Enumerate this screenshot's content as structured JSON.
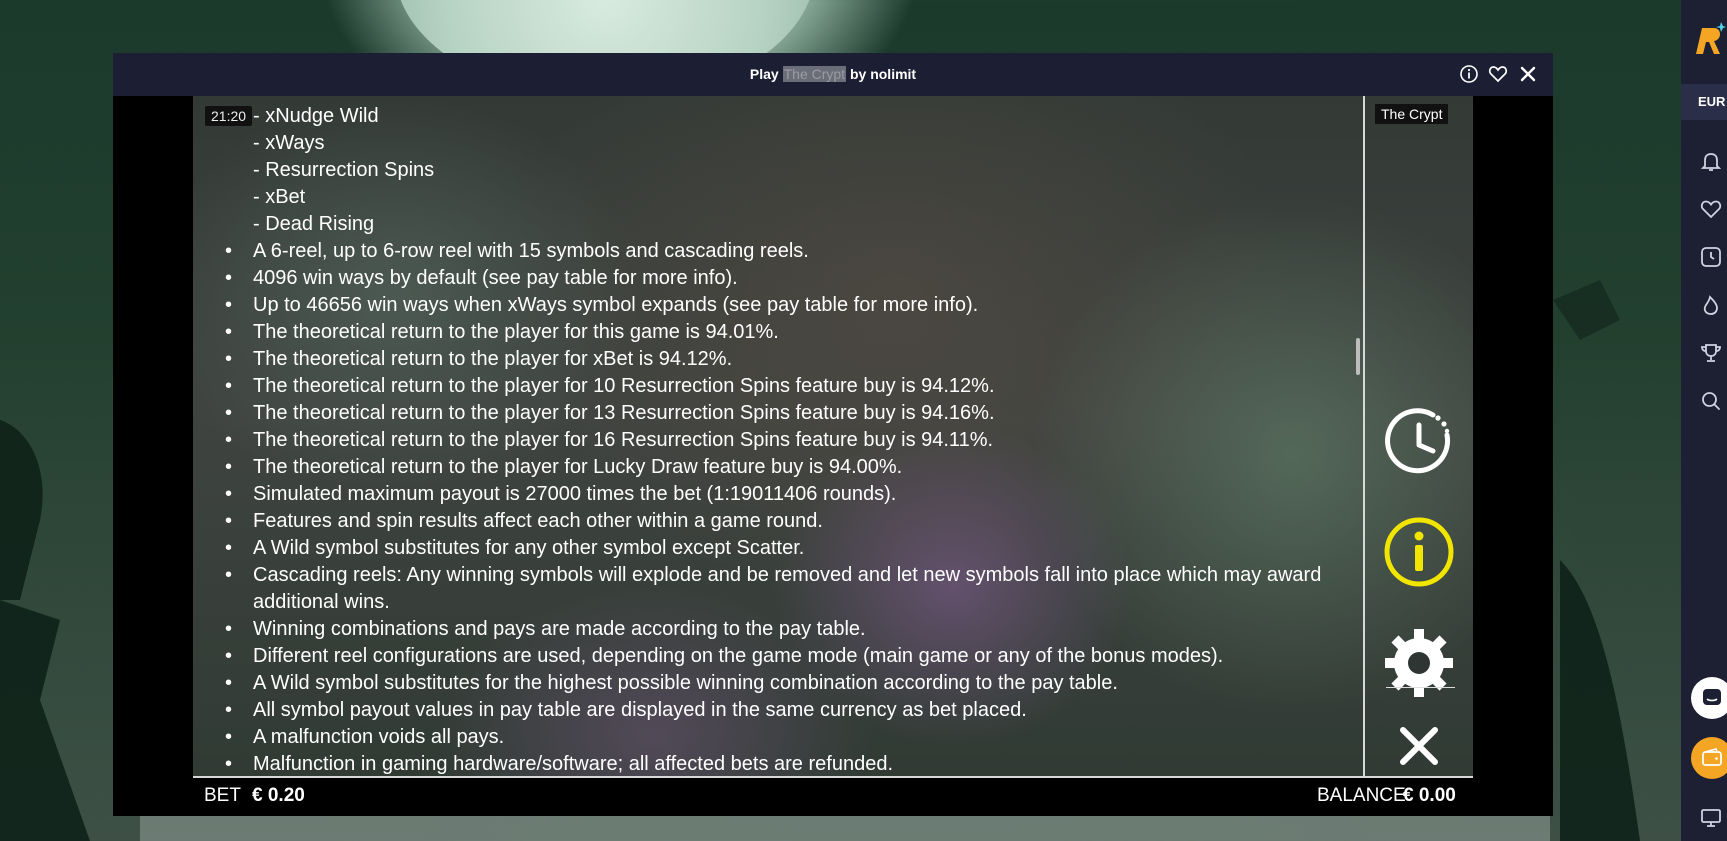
{
  "window": {
    "title_prefix": "Play ",
    "title_game": "The Crypt",
    "title_suffix": " by nolimit"
  },
  "game": {
    "clock": "21:20",
    "name_badge": "The Crypt",
    "rules_lines": [
      {
        "kind": "sub",
        "text": "- xNudge Wild"
      },
      {
        "kind": "sub",
        "text": "- xWays"
      },
      {
        "kind": "sub",
        "text": "- Resurrection Spins"
      },
      {
        "kind": "sub",
        "text": "- xBet"
      },
      {
        "kind": "sub",
        "text": "- Dead Rising"
      },
      {
        "kind": "bullet",
        "text": "A 6-reel, up to 6-row reel with 15 symbols and cascading reels."
      },
      {
        "kind": "bullet",
        "text": "4096 win ways by default (see pay table for more info)."
      },
      {
        "kind": "bullet",
        "text": "Up to 46656 win ways when xWays symbol expands (see pay table for more info)."
      },
      {
        "kind": "bullet",
        "text": "The theoretical return to the player for this game is 94.01%."
      },
      {
        "kind": "bullet",
        "text": "The theoretical return to the player for xBet is 94.12%."
      },
      {
        "kind": "bullet",
        "text": "The theoretical return to the player for 10 Resurrection Spins feature buy is 94.12%."
      },
      {
        "kind": "bullet",
        "text": "The theoretical return to the player for 13 Resurrection Spins feature buy is 94.16%."
      },
      {
        "kind": "bullet",
        "text": "The theoretical return to the player for 16 Resurrection Spins feature buy is 94.11%."
      },
      {
        "kind": "bullet",
        "text": "The theoretical return to the player for Lucky Draw feature buy is 94.00%."
      },
      {
        "kind": "bullet",
        "text": "Simulated maximum payout is 27000 times the bet (1:19011406 rounds)."
      },
      {
        "kind": "bullet",
        "text": "Features and spin results affect each other within a game round."
      },
      {
        "kind": "bullet",
        "text": "A Wild symbol substitutes for any other symbol except Scatter."
      },
      {
        "kind": "bullet",
        "text": "Cascading reels: Any winning symbols will explode and be removed and let new symbols fall into place which may award"
      },
      {
        "kind": "cont",
        "text": "additional wins."
      },
      {
        "kind": "bullet",
        "text": "Winning combinations and pays are made according to the pay table."
      },
      {
        "kind": "bullet",
        "text": "Different reel configurations are used, depending on the game mode (main game or any of the bonus modes)."
      },
      {
        "kind": "bullet",
        "text": "A Wild symbol substitutes for the highest possible winning combination according to the pay table."
      },
      {
        "kind": "bullet",
        "text": "All symbol payout values in pay table are displayed in the same currency as bet placed."
      },
      {
        "kind": "bullet",
        "text": "A malfunction voids all pays."
      },
      {
        "kind": "bullet",
        "text": "Malfunction in gaming hardware/software; all affected bets are refunded."
      }
    ],
    "bet_label": "BET",
    "bet_value": "€ 0.20",
    "balance_label": "BALANCE",
    "balance_value": "€ 0.00",
    "side_icons": [
      "history-icon",
      "info-icon",
      "settings-icon",
      "close-icon"
    ],
    "info_color": "#f2e600"
  },
  "site_sidebar": {
    "currency": "EUR",
    "icons": [
      "bell-icon",
      "heart-icon",
      "clock-icon",
      "fire-icon",
      "trophy-icon",
      "search-icon",
      "chat-icon",
      "wallet-icon",
      "monitor-icon"
    ],
    "accent": "#f5a524"
  }
}
